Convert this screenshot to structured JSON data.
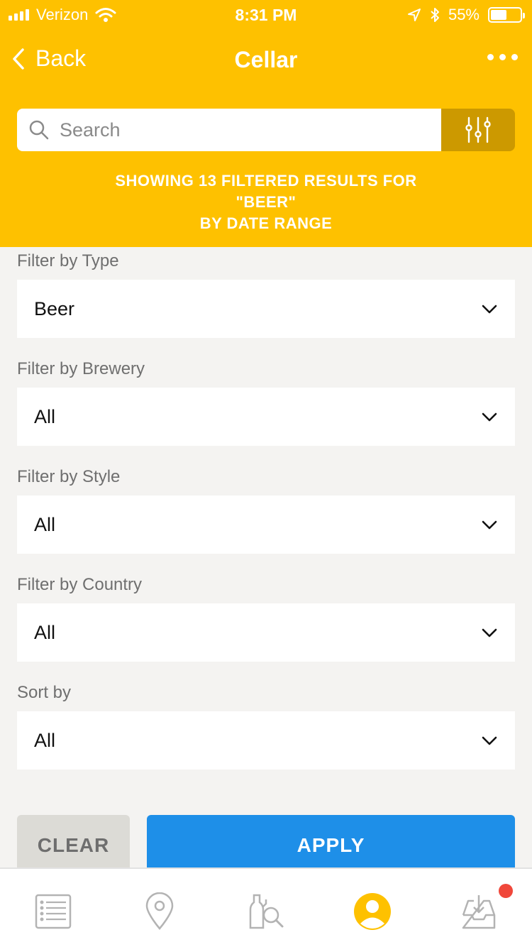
{
  "status_bar": {
    "carrier": "Verizon",
    "time": "8:31 PM",
    "battery": "55%",
    "battery_level": 0.55,
    "icons": [
      "signal-icon",
      "wifi-icon",
      "location-arrow-icon",
      "bluetooth-icon",
      "battery-icon"
    ]
  },
  "nav": {
    "back_label": "Back",
    "title": "Cellar"
  },
  "search": {
    "placeholder": "Search",
    "value": ""
  },
  "results": {
    "line1": "SHOWING 13 FILTERED RESULTS FOR",
    "line2": "\"BEER\"",
    "line3": "BY DATE RANGE"
  },
  "filters": [
    {
      "label": "Filter by Type",
      "value": "Beer"
    },
    {
      "label": "Filter by Brewery",
      "value": "All"
    },
    {
      "label": "Filter by Style",
      "value": "All"
    },
    {
      "label": "Filter by Country",
      "value": "All"
    },
    {
      "label": "Sort by",
      "value": "All"
    }
  ],
  "actions": {
    "clear_label": "CLEAR",
    "apply_label": "APPLY"
  },
  "tabs": [
    {
      "icon": "list-icon",
      "active": false
    },
    {
      "icon": "map-pin-icon",
      "active": false
    },
    {
      "icon": "bottle-search-icon",
      "active": false
    },
    {
      "icon": "profile-icon",
      "active": true
    },
    {
      "icon": "inbox-download-icon",
      "active": false,
      "has_badge": true
    }
  ],
  "colors": {
    "brand_yellow": "#fec100",
    "filter_button": "#cc9900",
    "apply_blue": "#1e8fe8",
    "clear_gray": "#dcdbd6",
    "badge_red": "#f0473a",
    "tab_inactive": "#b3b3b3"
  }
}
